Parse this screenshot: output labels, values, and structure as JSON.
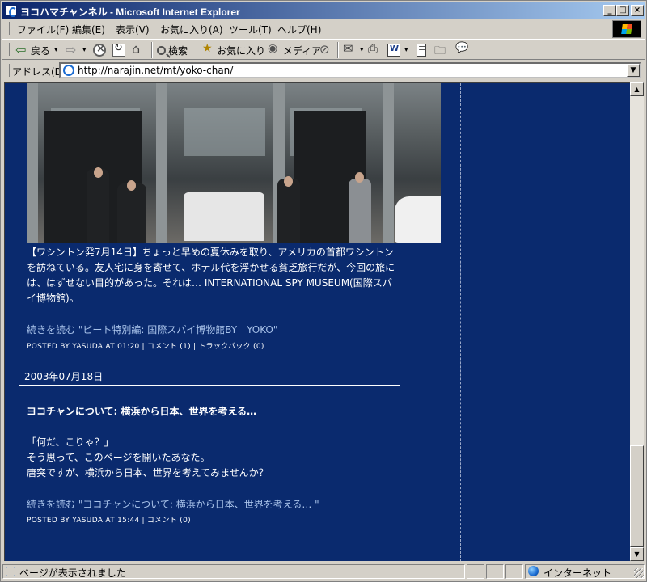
{
  "window": {
    "title": "ヨコハマチャンネル - Microsoft Internet Explorer",
    "controls": {
      "minimize": "_",
      "maximize": "□",
      "close": "×"
    }
  },
  "menu": {
    "items": [
      "ファイル(F)",
      "編集(E)",
      "表示(V)",
      "お気に入り(A)",
      "ツール(T)",
      "ヘルプ(H)"
    ]
  },
  "toolbar": {
    "back": "戻る",
    "search": "検索",
    "favorites": "お気に入り",
    "media": "メディア"
  },
  "address": {
    "label": "アドレス(D)",
    "url": "http://narajin.net/mt/yoko-chan/"
  },
  "content": {
    "entry1": {
      "paragraph": "【ワシントン発7月14日】ちょっと早めの夏休みを取り、アメリカの首都ワシントンを訪ねている。友人宅に身を寄せて、ホテル代を浮かせる貧乏旅行だが、今回の旅には、はずせない目的があった。それは… INTERNATIONAL SPY MUSEUM(国際スパイ博物館)。",
      "read_more": "続きを読む \"ビート特別編: 国際スパイ博物館BY　YOKO\"",
      "posted": "POSTED BY YASUDA AT 01:20",
      "comments": "コメント (1)",
      "trackback": "トラックバック (0)"
    },
    "date_header": "2003年07月18日",
    "entry2": {
      "title": "ヨコチャンについて: 横浜から日本、世界を考える…",
      "line1": "「何だ、こりゃ？」",
      "line2": "そう思って、このページを開いたあなた。",
      "line3": "唐突ですが、横浜から日本、世界を考えてみませんか？",
      "read_more": "続きを読む \"ヨコチャンについて: 横浜から日本、世界を考える… \"",
      "posted": "POSTED BY YASUDA AT 15:44",
      "comments": "コメント (0)"
    }
  },
  "status": {
    "message": "ページが表示されました",
    "zone": "インターネット"
  }
}
